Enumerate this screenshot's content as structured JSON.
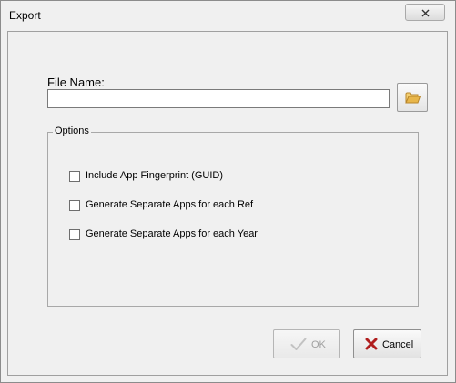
{
  "window": {
    "title": "Export"
  },
  "file": {
    "label": "File Name:",
    "value": "",
    "placeholder": "",
    "browse_icon": "folder-open-icon"
  },
  "options": {
    "legend": "Options",
    "items": [
      {
        "label": "Include App Fingerprint (GUID)",
        "checked": false
      },
      {
        "label": "Generate Separate Apps for each Ref",
        "checked": false
      },
      {
        "label": "Generate Separate Apps for each Year",
        "checked": false
      }
    ]
  },
  "buttons": {
    "ok": {
      "label": "OK",
      "enabled": false,
      "icon": "checkmark-icon"
    },
    "cancel": {
      "label": "Cancel",
      "enabled": true,
      "icon": "x-icon"
    }
  },
  "colors": {
    "cancel_icon": "#b01e1e",
    "folder_icon": "#e8b64a",
    "disabled_text": "#a0a0a0"
  }
}
